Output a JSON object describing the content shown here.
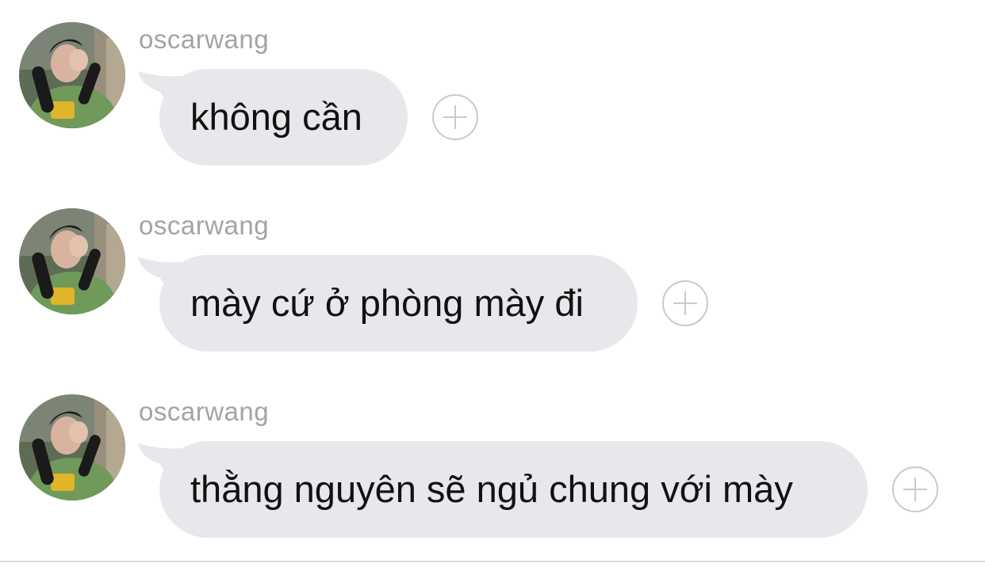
{
  "messages": [
    {
      "sender": "oscarwang",
      "text": "không cần",
      "avatar_icon": "user-avatar-photo",
      "react_icon": "add-reaction-icon"
    },
    {
      "sender": "oscarwang",
      "text": "mày cứ ở phòng mày đi",
      "avatar_icon": "user-avatar-photo",
      "react_icon": "add-reaction-icon"
    },
    {
      "sender": "oscarwang",
      "text": "thằng nguyên sẽ ngủ chung với mày",
      "avatar_icon": "user-avatar-photo",
      "react_icon": "add-reaction-icon"
    }
  ],
  "colors": {
    "bubble": "#e6e8eb",
    "sender_name": "#a3a3a8",
    "message_text": "#111111",
    "reaction_button": "#c9c9cc",
    "background": "#ffffff"
  }
}
